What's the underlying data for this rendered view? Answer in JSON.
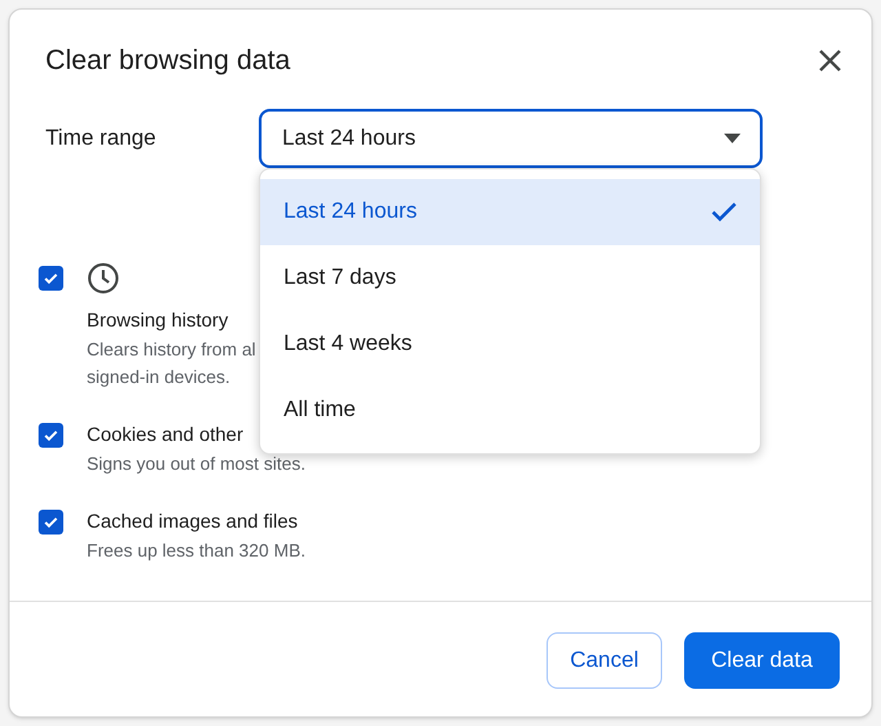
{
  "dialog": {
    "title": "Clear browsing data"
  },
  "time_range": {
    "label": "Time range",
    "value": "Last 24 hours",
    "expanded": true,
    "options": [
      {
        "label": "Last 24 hours",
        "selected": true
      },
      {
        "label": "Last 7 days",
        "selected": false
      },
      {
        "label": "Last 4 weeks",
        "selected": false
      },
      {
        "label": "All time",
        "selected": false
      }
    ]
  },
  "items": [
    {
      "label": "Browsing history",
      "checked": true,
      "has_icon": true,
      "description": [
        "Clears history from al",
        "signed-in devices."
      ]
    },
    {
      "label": "Cookies and other",
      "checked": true,
      "has_icon": false,
      "description": [
        "Signs you out of most sites."
      ]
    },
    {
      "label": "Cached images and files",
      "checked": true,
      "has_icon": false,
      "description": [
        "Frees up less than 320 MB."
      ]
    }
  ],
  "buttons": [
    {
      "label": "Cancel",
      "kind": "secondary"
    },
    {
      "label": "Clear data",
      "kind": "primary"
    }
  ]
}
